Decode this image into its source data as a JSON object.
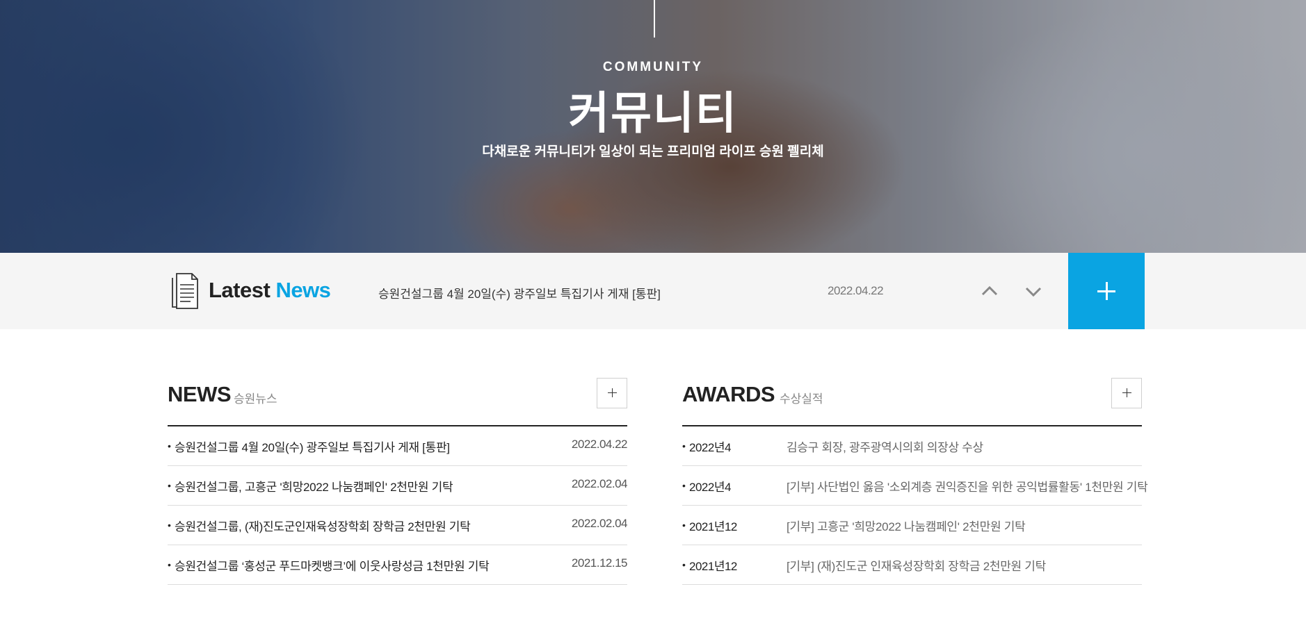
{
  "hero": {
    "eyebrow": "COMMUNITY",
    "title": "커뮤니티",
    "subtitle": "다채로운 커뮤니티가 일상이 되는 프리미엄 라이프 승원 펠리체"
  },
  "latest_news": {
    "title_prefix": "Latest",
    "title_accent": "News",
    "headline": "승원건설그룹 4월 20일(수) 광주일보 특집기사 게재 [통판]",
    "date": "2022.04.22",
    "accent_color": "#0aa4e2",
    "icons": {
      "doc": "document-icon",
      "up": "chevron-up-icon",
      "down": "chevron-down-icon",
      "plus": "plus-icon"
    }
  },
  "news": {
    "title": "NEWS",
    "subtitle": "승원뉴스",
    "items": [
      {
        "title": "승원건설그룹 4월 20일(수) 광주일보 특집기사 게재 [통판]",
        "date": "2022.04.22"
      },
      {
        "title": "승원건설그룹, 고흥군 '희망2022 나눔캠페인' 2천만원 기탁",
        "date": "2022.02.04"
      },
      {
        "title": "승원건설그룹, (재)진도군인재육성장학회 장학금 2천만원 기탁",
        "date": "2022.02.04"
      },
      {
        "title": "승원건설그룹 ‘홍성군 푸드마켓뱅크’에 이웃사랑성금 1천만원 기탁",
        "date": "2021.12.15"
      }
    ]
  },
  "awards": {
    "title": "AWARDS",
    "subtitle": "수상실적",
    "items": [
      {
        "year": "2022년4",
        "title": "김승구 회장, 광주광역시의회 의장상 수상"
      },
      {
        "year": "2022년4",
        "title": "[기부] 사단법인 옳음 '소외계층 권익증진을 위한 공익법률활동' 1천만원 기탁"
      },
      {
        "year": "2021년12",
        "title": "[기부] 고흥군 '희망2022 나눔캠페인' 2천만원 기탁"
      },
      {
        "year": "2021년12",
        "title": "[기부] (재)진도군 인재육성장학회 장학금 2천만원 기탁"
      }
    ]
  }
}
